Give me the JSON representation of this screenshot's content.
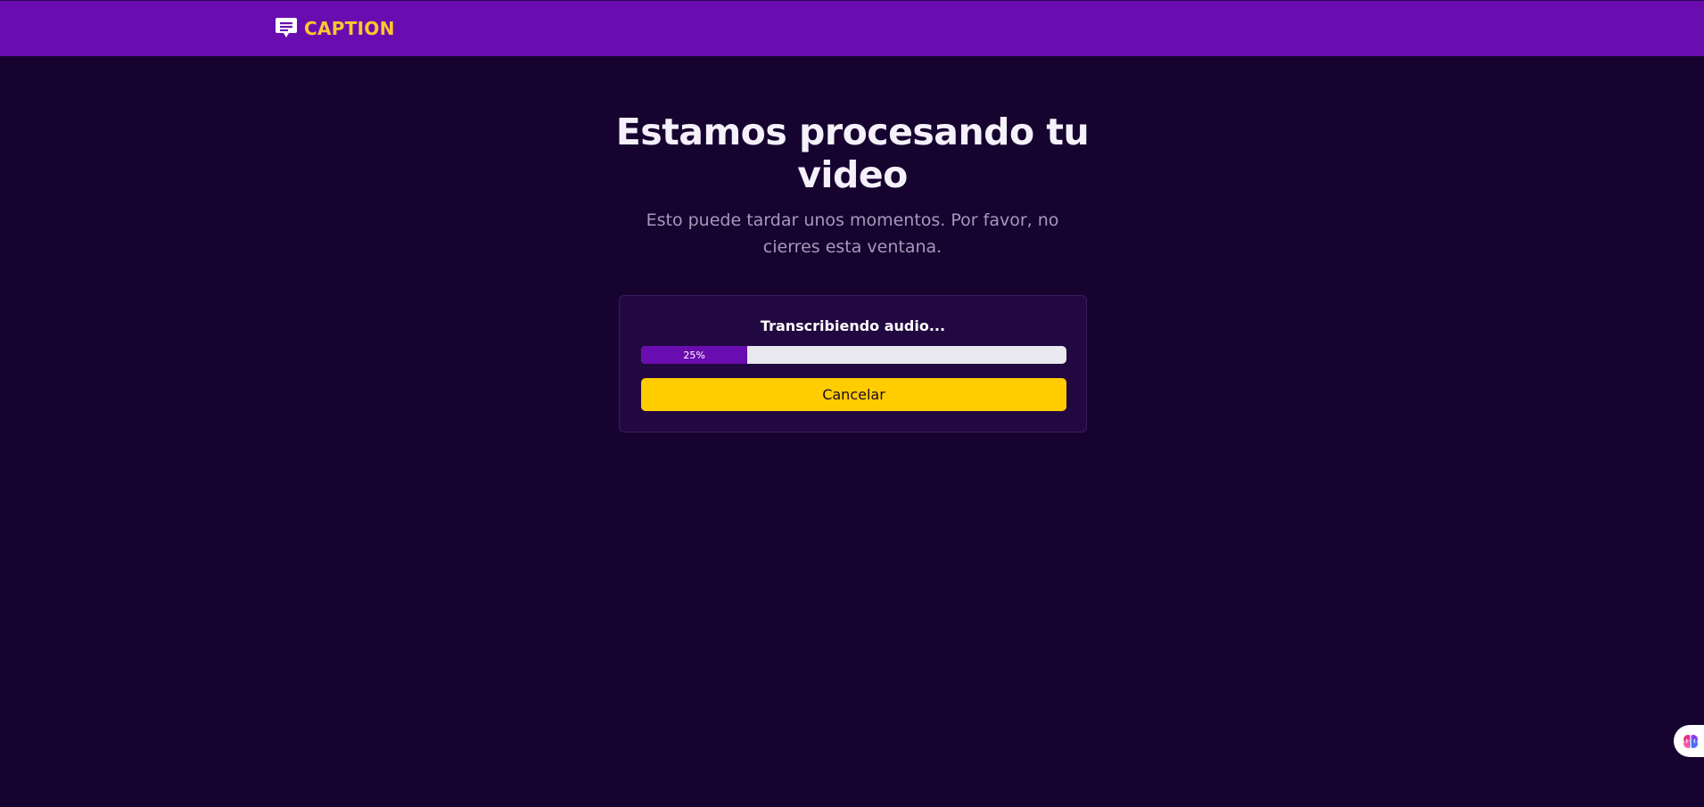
{
  "header": {
    "brand_name": "CAPTION",
    "brand_icon": "caption-chat-icon",
    "brand_color": "#ffc72c",
    "bar_color": "#6a0db0"
  },
  "main": {
    "title": "Estamos procesando tu video",
    "subtitle": "Esto puede tardar unos momentos. Por favor, no cierres esta ventana."
  },
  "progress_card": {
    "status": "Transcribiendo audio...",
    "progress_value": 0.25,
    "progress_label": "25%",
    "fill_color": "#6a0db0",
    "cancel_label": "Cancelar",
    "cancel_color": "#ffcc00"
  },
  "floating_widget": {
    "icon": "brain-icon"
  }
}
